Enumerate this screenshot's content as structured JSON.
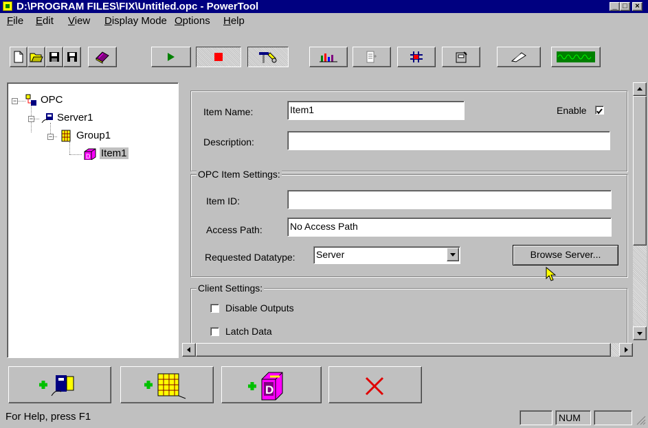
{
  "window": {
    "title": "D:\\PROGRAM FILES\\FIX\\Untitled.opc - PowerTool",
    "minimize_glyph": "_",
    "maximize_glyph": "□",
    "close_glyph": "×"
  },
  "menu": [
    {
      "label": "File",
      "accel": "F"
    },
    {
      "label": "Edit",
      "accel": "E"
    },
    {
      "label": "View",
      "accel": "V"
    },
    {
      "label": "Display Mode",
      "accel": "D"
    },
    {
      "label": "Options",
      "accel": "O"
    },
    {
      "label": "Help",
      "accel": "H"
    }
  ],
  "toolbar_icons": [
    "new-icon",
    "open-icon",
    "save-icon",
    "save-all-icon",
    "book-icon",
    "start-icon",
    "stop-icon",
    "tools-icon",
    "chart-icon",
    "properties-icon",
    "grid-icon",
    "config-icon",
    "signal-icon",
    "monitor-icon"
  ],
  "tree": {
    "root": "OPC",
    "server": "Server1",
    "group": "Group1",
    "item": "Item1"
  },
  "item": {
    "name_label": "Item Name:",
    "name_value": "Item1",
    "enable_label": "Enable",
    "enable_checked": true,
    "description_label": "Description:",
    "description_value": ""
  },
  "opc_settings": {
    "legend": "OPC Item Settings:",
    "item_id_label": "Item ID:",
    "item_id_value": "",
    "access_path_label": "Access Path:",
    "access_path_value": "No Access Path",
    "datatype_label": "Requested Datatype:",
    "datatype_value": "Server",
    "browse_button": "Browse Server..."
  },
  "client_settings": {
    "legend": "Client Settings:",
    "disable_outputs_label": "Disable Outputs",
    "disable_outputs_checked": false,
    "latch_data_label": "Latch Data",
    "latch_data_checked": false
  },
  "bottom_buttons": [
    "add-server-icon",
    "add-group-icon",
    "add-item-icon",
    "delete-icon"
  ],
  "status": {
    "help_text": "For Help, press F1",
    "num_indicator": "NUM"
  },
  "colors": {
    "titlebar": "#000080",
    "face": "#c0c0c0",
    "selection": "#c0c0c0"
  }
}
